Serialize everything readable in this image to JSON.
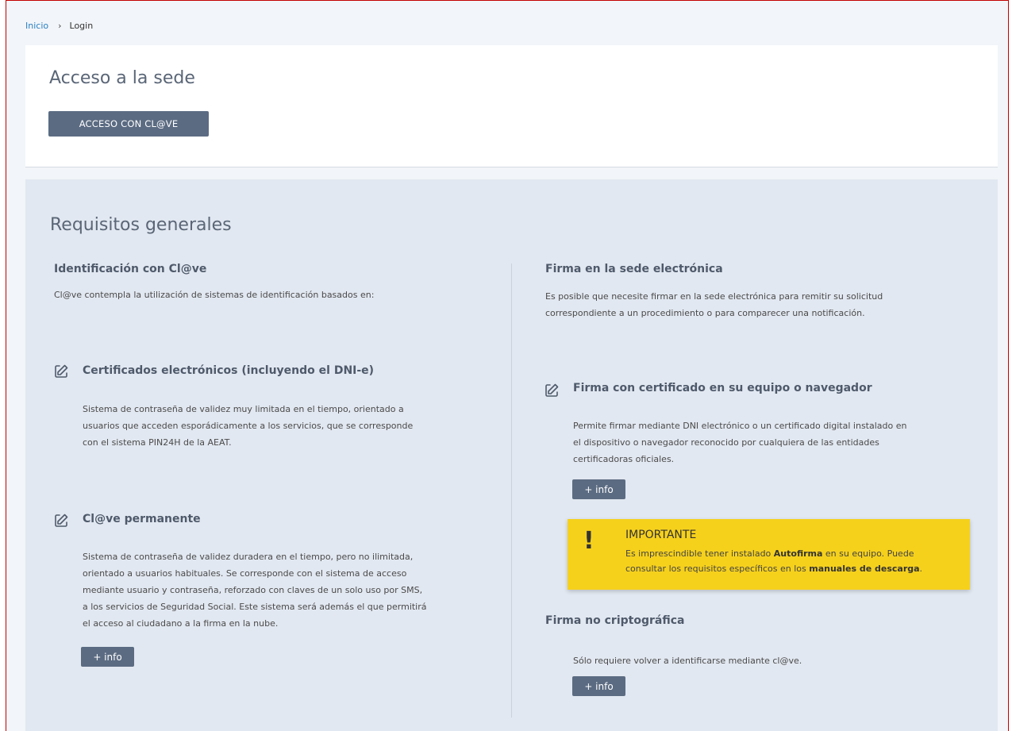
{
  "breadcrumb": {
    "home": "Inicio",
    "separator": "›",
    "current": "Login"
  },
  "top": {
    "title": "Acceso a la sede",
    "clave_button": "ACCESO CON CL@VE"
  },
  "requirements": {
    "title": "Requisitos generales",
    "left": {
      "heading": "Identificación con Cl@ve",
      "intro": "Cl@ve contempla la utilización de sistemas de identificación basados en:",
      "items": [
        {
          "icon": "edit-icon",
          "title": "Certificados electrónicos (incluyendo el DNI-e)",
          "lines": [
            "Sistema de contraseña de validez muy limitada en el tiempo, orientado a",
            "usuarios que acceden esporádicamente a los servicios, que se corresponde",
            "con el sistema PIN24H de la AEAT."
          ]
        },
        {
          "icon": "edit-icon",
          "title": "Cl@ve permanente",
          "lines": [
            "Sistema de contraseña de validez duradera en el tiempo, pero no ilimitada,",
            "orientado a usuarios habituales. Se corresponde con el sistema de acceso",
            "mediante usuario y contraseña, reforzado con claves de un solo uso por SMS,",
            "a los servicios de Seguridad Social. Este sistema será además el que permitirá",
            "el acceso al ciudadano a la firma en la nube."
          ],
          "button": "+ info"
        }
      ]
    },
    "right": {
      "heading": "Firma en la sede electrónica",
      "intro_lines": [
        "Es posible que necesite firmar en la sede electrónica para remitir su solicitud",
        "correspondiente a un procedimiento o para comparecer una notificación."
      ],
      "cert": {
        "icon": "edit-icon",
        "title": "Firma con certificado en su equipo o navegador",
        "lines": [
          "Permite firmar mediante DNI electrónico o un certificado digital instalado en",
          "el dispositivo o navegador reconocido por cualquiera de las entidades",
          "certificadoras oficiales."
        ],
        "button": "+ info"
      },
      "important": {
        "symbol": "!",
        "title": "IMPORTANTE",
        "line1_pre": "Es imprescindible tener instalado ",
        "line1_bold": "Autofirma",
        "line1_post": " en su equipo. Puede",
        "line2_pre": "consultar los requisitos específicos en los ",
        "line2_bold": "manuales de descarga",
        "line2_post": "."
      },
      "nocrypto": {
        "title": "Firma no criptográfica",
        "text": "Sólo requiere volver a identificarse mediante cl@ve.",
        "button": "+ info"
      }
    }
  }
}
